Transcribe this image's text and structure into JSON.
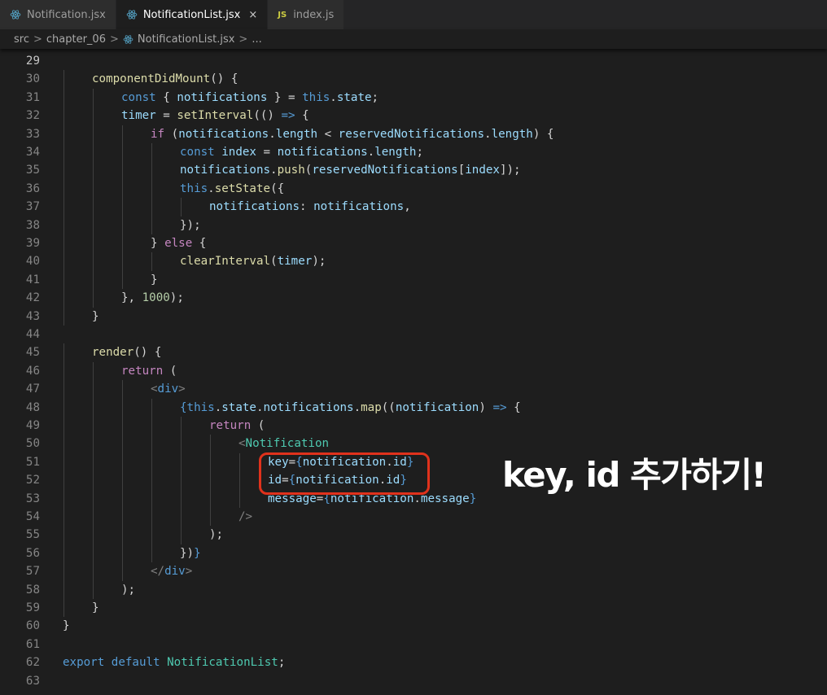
{
  "tabs": [
    {
      "label": "Notification.jsx",
      "icon": "react-icon",
      "active": false
    },
    {
      "label": "NotificationList.jsx",
      "icon": "react-icon",
      "active": true,
      "close": "×"
    },
    {
      "label": "index.js",
      "icon": "js-icon",
      "icon_text": "JS",
      "active": false
    }
  ],
  "breadcrumb": {
    "items": [
      "src",
      "chapter_06",
      "NotificationList.jsx",
      "..."
    ],
    "separator": ">"
  },
  "editor": {
    "current_line": "29",
    "lines": [
      {
        "n": "29",
        "indent": 0,
        "tokens": []
      },
      {
        "n": "30",
        "indent": 1,
        "tokens": [
          {
            "c": "fn",
            "t": "componentDidMount"
          },
          {
            "c": "plain",
            "t": "() {"
          }
        ]
      },
      {
        "n": "31",
        "indent": 2,
        "tokens": [
          {
            "c": "kw",
            "t": "const"
          },
          {
            "c": "plain",
            "t": " { "
          },
          {
            "c": "var",
            "t": "notifications"
          },
          {
            "c": "plain",
            "t": " } = "
          },
          {
            "c": "kw",
            "t": "this"
          },
          {
            "c": "plain",
            "t": "."
          },
          {
            "c": "var",
            "t": "state"
          },
          {
            "c": "plain",
            "t": ";"
          }
        ]
      },
      {
        "n": "32",
        "indent": 2,
        "tokens": [
          {
            "c": "var",
            "t": "timer"
          },
          {
            "c": "plain",
            "t": " = "
          },
          {
            "c": "fn",
            "t": "setInterval"
          },
          {
            "c": "plain",
            "t": "(() "
          },
          {
            "c": "kw",
            "t": "=>"
          },
          {
            "c": "plain",
            "t": " {"
          }
        ]
      },
      {
        "n": "33",
        "indent": 3,
        "tokens": [
          {
            "c": "ctl",
            "t": "if"
          },
          {
            "c": "plain",
            "t": " ("
          },
          {
            "c": "var",
            "t": "notifications"
          },
          {
            "c": "plain",
            "t": "."
          },
          {
            "c": "var",
            "t": "length"
          },
          {
            "c": "plain",
            "t": " < "
          },
          {
            "c": "var",
            "t": "reservedNotifications"
          },
          {
            "c": "plain",
            "t": "."
          },
          {
            "c": "var",
            "t": "length"
          },
          {
            "c": "plain",
            "t": ") {"
          }
        ]
      },
      {
        "n": "34",
        "indent": 4,
        "tokens": [
          {
            "c": "kw",
            "t": "const"
          },
          {
            "c": "plain",
            "t": " "
          },
          {
            "c": "var",
            "t": "index"
          },
          {
            "c": "plain",
            "t": " = "
          },
          {
            "c": "var",
            "t": "notifications"
          },
          {
            "c": "plain",
            "t": "."
          },
          {
            "c": "var",
            "t": "length"
          },
          {
            "c": "plain",
            "t": ";"
          }
        ]
      },
      {
        "n": "35",
        "indent": 4,
        "tokens": [
          {
            "c": "var",
            "t": "notifications"
          },
          {
            "c": "plain",
            "t": "."
          },
          {
            "c": "fn",
            "t": "push"
          },
          {
            "c": "plain",
            "t": "("
          },
          {
            "c": "var",
            "t": "reservedNotifications"
          },
          {
            "c": "plain",
            "t": "["
          },
          {
            "c": "var",
            "t": "index"
          },
          {
            "c": "plain",
            "t": "]);"
          }
        ]
      },
      {
        "n": "36",
        "indent": 4,
        "tokens": [
          {
            "c": "kw",
            "t": "this"
          },
          {
            "c": "plain",
            "t": "."
          },
          {
            "c": "fn",
            "t": "setState"
          },
          {
            "c": "plain",
            "t": "({"
          }
        ]
      },
      {
        "n": "37",
        "indent": 5,
        "tokens": [
          {
            "c": "var",
            "t": "notifications"
          },
          {
            "c": "plain",
            "t": ": "
          },
          {
            "c": "var",
            "t": "notifications"
          },
          {
            "c": "plain",
            "t": ","
          }
        ]
      },
      {
        "n": "38",
        "indent": 4,
        "tokens": [
          {
            "c": "plain",
            "t": "});"
          }
        ]
      },
      {
        "n": "39",
        "indent": 3,
        "tokens": [
          {
            "c": "plain",
            "t": "} "
          },
          {
            "c": "ctl",
            "t": "else"
          },
          {
            "c": "plain",
            "t": " {"
          }
        ]
      },
      {
        "n": "40",
        "indent": 4,
        "tokens": [
          {
            "c": "fn",
            "t": "clearInterval"
          },
          {
            "c": "plain",
            "t": "("
          },
          {
            "c": "var",
            "t": "timer"
          },
          {
            "c": "plain",
            "t": ");"
          }
        ]
      },
      {
        "n": "41",
        "indent": 3,
        "tokens": [
          {
            "c": "plain",
            "t": "}"
          }
        ]
      },
      {
        "n": "42",
        "indent": 2,
        "tokens": [
          {
            "c": "plain",
            "t": "}, "
          },
          {
            "c": "num",
            "t": "1000"
          },
          {
            "c": "plain",
            "t": ");"
          }
        ]
      },
      {
        "n": "43",
        "indent": 1,
        "tokens": [
          {
            "c": "plain",
            "t": "}"
          }
        ]
      },
      {
        "n": "44",
        "indent": 0,
        "tokens": []
      },
      {
        "n": "45",
        "indent": 1,
        "tokens": [
          {
            "c": "fn",
            "t": "render"
          },
          {
            "c": "plain",
            "t": "() {"
          }
        ]
      },
      {
        "n": "46",
        "indent": 2,
        "tokens": [
          {
            "c": "ctl",
            "t": "return"
          },
          {
            "c": "plain",
            "t": " ("
          }
        ]
      },
      {
        "n": "47",
        "indent": 3,
        "tokens": [
          {
            "c": "tagp",
            "t": "<"
          },
          {
            "c": "kw",
            "t": "div"
          },
          {
            "c": "tagp",
            "t": ">"
          }
        ]
      },
      {
        "n": "48",
        "indent": 4,
        "tokens": [
          {
            "c": "kw",
            "t": "{"
          },
          {
            "c": "kw",
            "t": "this"
          },
          {
            "c": "plain",
            "t": "."
          },
          {
            "c": "var",
            "t": "state"
          },
          {
            "c": "plain",
            "t": "."
          },
          {
            "c": "var",
            "t": "notifications"
          },
          {
            "c": "plain",
            "t": "."
          },
          {
            "c": "fn",
            "t": "map"
          },
          {
            "c": "plain",
            "t": "(("
          },
          {
            "c": "var",
            "t": "notification"
          },
          {
            "c": "plain",
            "t": ") "
          },
          {
            "c": "kw",
            "t": "=>"
          },
          {
            "c": "plain",
            "t": " {"
          }
        ]
      },
      {
        "n": "49",
        "indent": 5,
        "tokens": [
          {
            "c": "ctl",
            "t": "return"
          },
          {
            "c": "plain",
            "t": " ("
          }
        ]
      },
      {
        "n": "50",
        "indent": 6,
        "tokens": [
          {
            "c": "tagp",
            "t": "<"
          },
          {
            "c": "tag",
            "t": "Notification"
          }
        ]
      },
      {
        "n": "51",
        "indent": 7,
        "tokens": [
          {
            "c": "attr",
            "t": "key"
          },
          {
            "c": "plain",
            "t": "="
          },
          {
            "c": "kw",
            "t": "{"
          },
          {
            "c": "var",
            "t": "notification"
          },
          {
            "c": "plain",
            "t": "."
          },
          {
            "c": "var",
            "t": "id"
          },
          {
            "c": "kw",
            "t": "}"
          }
        ]
      },
      {
        "n": "52",
        "indent": 7,
        "tokens": [
          {
            "c": "attr",
            "t": "id"
          },
          {
            "c": "plain",
            "t": "="
          },
          {
            "c": "kw",
            "t": "{"
          },
          {
            "c": "var",
            "t": "notification"
          },
          {
            "c": "plain",
            "t": "."
          },
          {
            "c": "var",
            "t": "id"
          },
          {
            "c": "kw",
            "t": "}"
          }
        ]
      },
      {
        "n": "53",
        "indent": 7,
        "tokens": [
          {
            "c": "attr",
            "t": "message"
          },
          {
            "c": "plain",
            "t": "="
          },
          {
            "c": "kw",
            "t": "{"
          },
          {
            "c": "var",
            "t": "notification"
          },
          {
            "c": "plain",
            "t": "."
          },
          {
            "c": "var",
            "t": "message"
          },
          {
            "c": "kw",
            "t": "}"
          }
        ]
      },
      {
        "n": "54",
        "indent": 6,
        "tokens": [
          {
            "c": "tagp",
            "t": "/>"
          }
        ]
      },
      {
        "n": "55",
        "indent": 5,
        "tokens": [
          {
            "c": "plain",
            "t": ");"
          }
        ]
      },
      {
        "n": "56",
        "indent": 4,
        "tokens": [
          {
            "c": "plain",
            "t": "})"
          },
          {
            "c": "kw",
            "t": "}"
          }
        ]
      },
      {
        "n": "57",
        "indent": 3,
        "tokens": [
          {
            "c": "tagp",
            "t": "</"
          },
          {
            "c": "kw",
            "t": "div"
          },
          {
            "c": "tagp",
            "t": ">"
          }
        ]
      },
      {
        "n": "58",
        "indent": 2,
        "tokens": [
          {
            "c": "plain",
            "t": ");"
          }
        ]
      },
      {
        "n": "59",
        "indent": 1,
        "tokens": [
          {
            "c": "plain",
            "t": "}"
          }
        ]
      },
      {
        "n": "60",
        "indent": 0,
        "tokens": [
          {
            "c": "plain",
            "t": "}"
          }
        ]
      },
      {
        "n": "61",
        "indent": 0,
        "tokens": []
      },
      {
        "n": "62",
        "indent": 0,
        "tokens": [
          {
            "c": "kw",
            "t": "export"
          },
          {
            "c": "plain",
            "t": " "
          },
          {
            "c": "kw",
            "t": "default"
          },
          {
            "c": "plain",
            "t": " "
          },
          {
            "c": "tag",
            "t": "NotificationList"
          },
          {
            "c": "plain",
            "t": ";"
          }
        ]
      },
      {
        "n": "63",
        "indent": 0,
        "tokens": []
      }
    ]
  },
  "annotation": {
    "text": "key, id 추가하기!"
  },
  "colors": {
    "background": "#1e1e1e",
    "tabbar": "#252526",
    "keyword": "#569cd6",
    "control": "#c586c0",
    "function": "#dcdcaa",
    "variable": "#9cdcfe",
    "number": "#b5cea8",
    "component": "#4ec9b0",
    "highlight_box": "#e0321c",
    "react_icon": "#519aba"
  }
}
